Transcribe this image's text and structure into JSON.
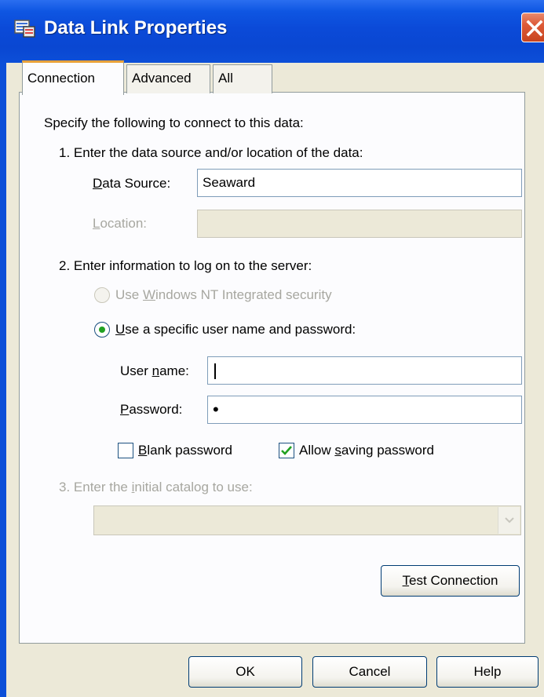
{
  "window": {
    "title": "Data Link Properties"
  },
  "tabs": [
    {
      "label": "Connection"
    },
    {
      "label": "Advanced"
    },
    {
      "label": "All"
    }
  ],
  "connection": {
    "intro": "Specify the following to connect to this data:",
    "step1": "1. Enter the data source and/or location of the data:",
    "data_source": {
      "label_accel": "D",
      "label_rest": "ata Source:",
      "value": "Seaward"
    },
    "location": {
      "label_accel": "L",
      "label_rest": "ocation:",
      "value": ""
    },
    "step2": "2. Enter information to log on to the server:",
    "radio_nt": {
      "prefix": "Use ",
      "accel": "W",
      "rest": "indows NT Integrated security",
      "checked": false,
      "enabled": false
    },
    "radio_specific": {
      "accel": "U",
      "rest": "se a specific user name and password:",
      "checked": true,
      "enabled": true
    },
    "username": {
      "label_pre": "User ",
      "label_accel": "n",
      "label_rest": "ame:",
      "value": ""
    },
    "password": {
      "label_accel": "P",
      "label_rest": "assword:",
      "value": "•"
    },
    "blank_password": {
      "accel": "B",
      "rest": "lank password",
      "checked": false
    },
    "allow_saving": {
      "pre": "Allow ",
      "accel": "s",
      "rest": "aving password",
      "checked": true
    },
    "step3": {
      "pre": "3. Enter the ",
      "accel": "i",
      "rest": "nitial catalog to use:",
      "enabled": false
    },
    "catalog_value": "",
    "test_button": {
      "accel": "T",
      "rest": "est Connection"
    }
  },
  "footer": {
    "ok": "OK",
    "cancel": "Cancel",
    "help": "Help"
  },
  "colors": {
    "titlebar": "#0a47d2",
    "close": "#dd5a38",
    "tab_highlight": "#e8a23b",
    "radio_dot": "#21a121",
    "check_mark": "#21a121"
  }
}
